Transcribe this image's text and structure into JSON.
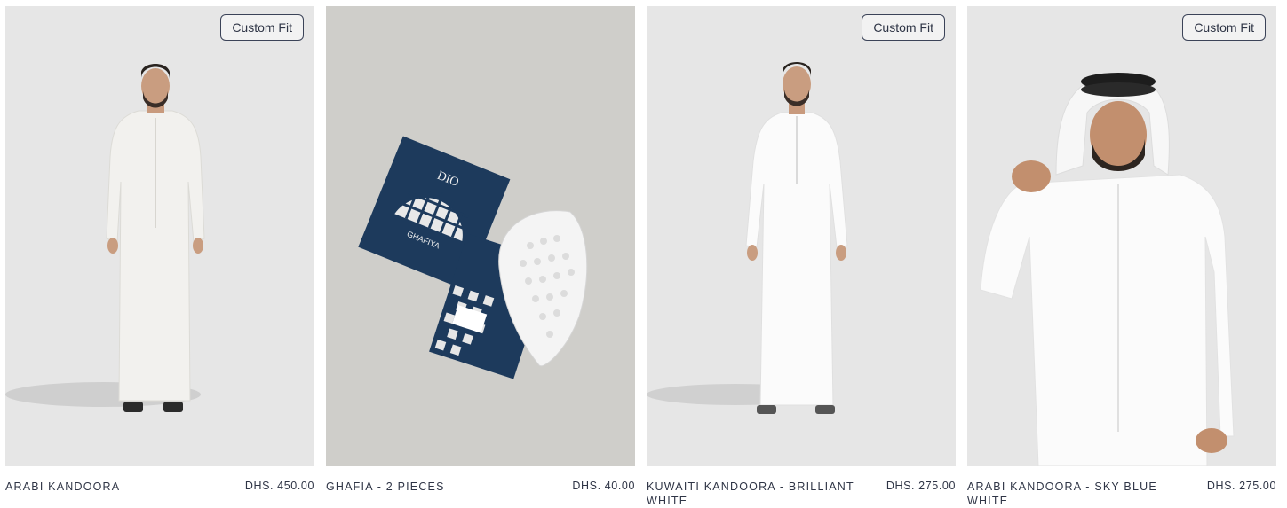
{
  "products": [
    {
      "name": "ARABI KANDOORA",
      "price": "DHS. 450.00",
      "badge": "Custom Fit"
    },
    {
      "name": "GHAFIA - 2 PIECES",
      "price": "DHS. 40.00"
    },
    {
      "name": "KUWAITI KANDOORA - BRILLIANT WHITE",
      "price": "DHS. 275.00",
      "badge": "Custom Fit"
    },
    {
      "name": "ARABI KANDOORA - SKY BLUE WHITE",
      "price": "DHS. 275.00",
      "badge": "Custom Fit"
    }
  ],
  "packaging": {
    "brand": "DIO",
    "label": "GHAFIYA"
  },
  "colors": {
    "text": "#2f3546",
    "card_bg": "#e6e6e6",
    "navy": "#1d3a5c"
  }
}
